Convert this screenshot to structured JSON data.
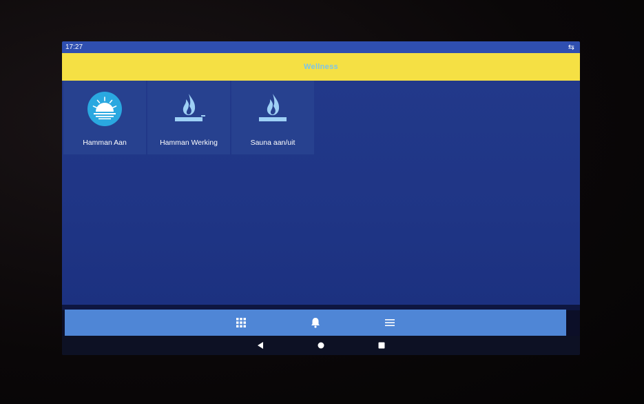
{
  "status_bar": {
    "time": "17:27",
    "right_icon": "sync-icon"
  },
  "header": {
    "title": "Wellness"
  },
  "tiles": [
    {
      "label": "Hamman Aan",
      "icon": "sunrise-icon"
    },
    {
      "label": "Hamman Werking",
      "icon": "flame-icon"
    },
    {
      "label": "Sauna aan/uit",
      "icon": "flame-icon"
    }
  ],
  "bottom_nav": {
    "items": [
      "grid-icon",
      "bell-icon",
      "menu-icon"
    ]
  },
  "system_nav": {
    "items": [
      "back-icon",
      "home-icon",
      "recents-icon"
    ]
  },
  "colors": {
    "status_bar": "#2f4fb0",
    "header": "#f5e044",
    "background": "#22398a",
    "tile": "#27418f",
    "bottom_nav": "#4f86d6",
    "accent": "#2aa8e0"
  }
}
